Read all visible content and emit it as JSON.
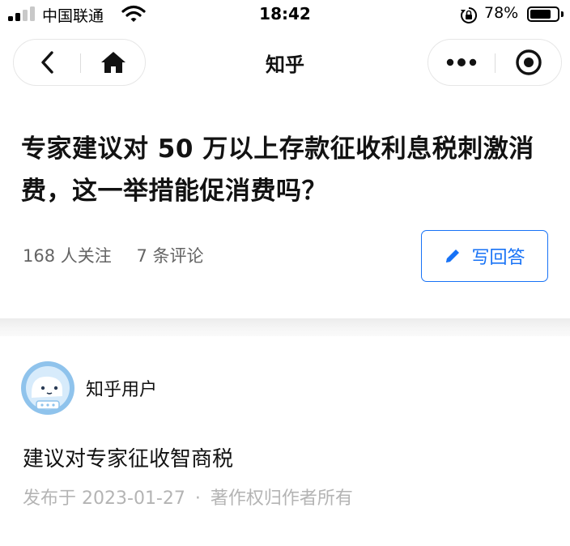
{
  "status_bar": {
    "carrier": "中国联通",
    "time": "18:42",
    "battery_percent": "78%",
    "battery_level": 0.78
  },
  "nav": {
    "title": "知乎",
    "back_icon": "chevron-left-icon",
    "home_icon": "home-icon",
    "more_icon": "more-dots-icon",
    "close_icon": "target-circle-icon"
  },
  "question": {
    "title": "专家建议对 50 万以上存款征收利息税刺激消费，这一举措能促消费吗？",
    "followers": "168 人关注",
    "comments": "7 条评论",
    "answer_button_label": "写回答"
  },
  "answer": {
    "author": "知乎用户",
    "content": "建议对专家征收智商税",
    "publish_prefix": "发布于",
    "publish_date": "2023-01-27",
    "separator": "·",
    "copyright": "著作权归作者所有"
  },
  "colors": {
    "accent": "#1772f6",
    "text_primary": "#121212",
    "text_secondary": "#646464",
    "text_muted": "#b4b4b4"
  }
}
